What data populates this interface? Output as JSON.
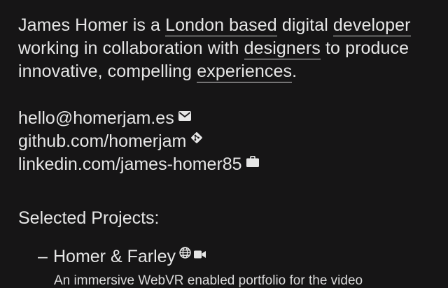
{
  "bio": {
    "line1_pre": "James Homer is a ",
    "line1_link1": "London based",
    "line1_mid": " digital ",
    "line1_link2": "developer",
    "line2_pre": "working in collaboration with ",
    "line2_link": "designers",
    "line2_post": " to produce",
    "line3_pre": "innovative, compelling ",
    "line3_link": "experiences",
    "line3_post": "."
  },
  "contacts": [
    {
      "text": "hello@homerjam.es",
      "icon": "envelope-icon"
    },
    {
      "text": "github.com/homerjam",
      "icon": "git-icon"
    },
    {
      "text": "linkedin.com/james-homer85",
      "icon": "briefcase-icon"
    }
  ],
  "projects_title": "Selected Projects:",
  "projects": [
    {
      "dash": "–",
      "name": "Homer & Farley",
      "icons": [
        "globe-icon",
        "video-camera-icon"
      ],
      "description": "An immersive WebVR enabled portfolio for the video"
    }
  ],
  "colors": {
    "background": "#161516",
    "text": "#e6e6e6"
  }
}
